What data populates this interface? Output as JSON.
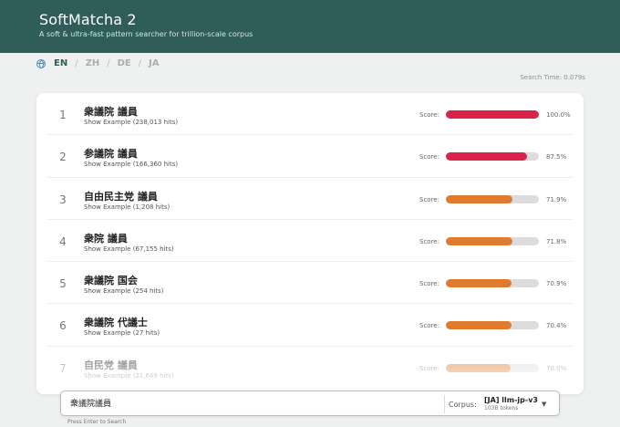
{
  "header": {
    "title": "SoftMatcha 2",
    "subtitle": "A soft & ultra-fast pattern searcher for trillion-scale corpus"
  },
  "languages": [
    "EN",
    "ZH",
    "DE",
    "JA"
  ],
  "active_language": "EN",
  "search_time": "Search Time: 0.079s",
  "results": [
    {
      "rank": "1",
      "phrase": "衆議院 議員",
      "example": "Show Example (238,013 hits)",
      "score_label": "Score:",
      "score": "100.0%",
      "fraction": 1.0,
      "color": "#dc2248"
    },
    {
      "rank": "2",
      "phrase": "参議院 議員",
      "example": "Show Example (166,360 hits)",
      "score_label": "Score:",
      "score": "87.5%",
      "fraction": 0.875,
      "color": "#dc2248"
    },
    {
      "rank": "3",
      "phrase": "自由民主党 議員",
      "example": "Show Example (1,208 hits)",
      "score_label": "Score:",
      "score": "71.9%",
      "fraction": 0.719,
      "color": "#e07a2e"
    },
    {
      "rank": "4",
      "phrase": "衆院 議員",
      "example": "Show Example (67,155 hits)",
      "score_label": "Score:",
      "score": "71.8%",
      "fraction": 0.718,
      "color": "#e07a2e"
    },
    {
      "rank": "5",
      "phrase": "衆議院 国会",
      "example": "Show Example (254 hits)",
      "score_label": "Score:",
      "score": "70.9%",
      "fraction": 0.709,
      "color": "#e07a2e"
    },
    {
      "rank": "6",
      "phrase": "衆議院 代議士",
      "example": "Show Example (27 hits)",
      "score_label": "Score:",
      "score": "70.4%",
      "fraction": 0.704,
      "color": "#e07a2e"
    },
    {
      "rank": "7",
      "phrase": "自民党 議員",
      "example": "Show Example (21,649 hits)",
      "score_label": "Score:",
      "score": "70.0%",
      "fraction": 0.7,
      "color": "#e07a2e"
    }
  ],
  "search": {
    "value": "衆議院議員",
    "corpus_label": "Corpus:",
    "corpus_name": "[JA] llm-jp-v3",
    "corpus_tokens": "103B tokens",
    "hint": "Press Enter to Search"
  }
}
